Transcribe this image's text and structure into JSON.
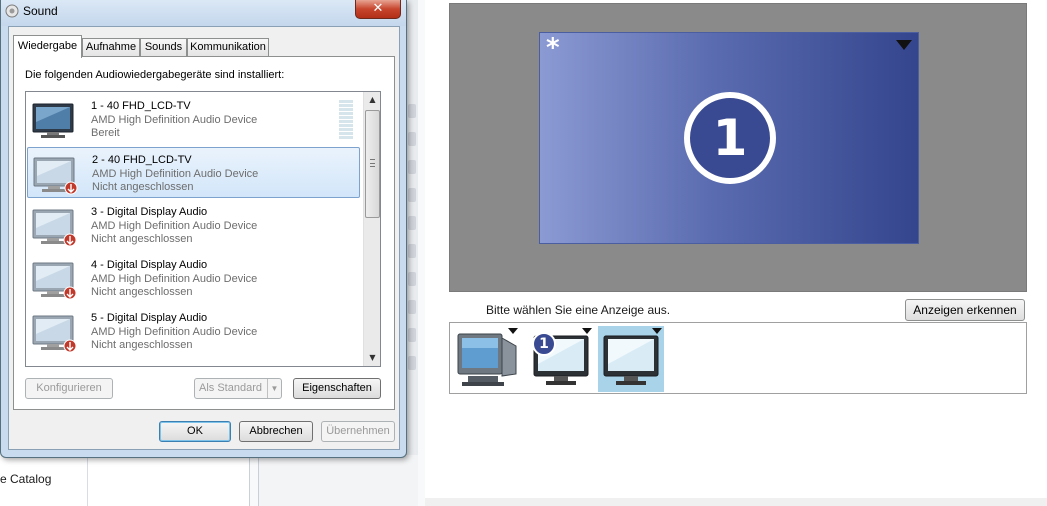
{
  "background": {
    "catalog_text": "e Catalog"
  },
  "dialog": {
    "title": "Sound",
    "close_label": "✕",
    "tabs": [
      {
        "label": "Wiedergabe",
        "active": true
      },
      {
        "label": "Aufnahme",
        "active": false
      },
      {
        "label": "Sounds",
        "active": false
      },
      {
        "label": "Kommunikation",
        "active": false
      }
    ],
    "description": "Die folgenden Audiowiedergabegeräte sind installiert:",
    "devices": [
      {
        "name": "1 - 40 FHD_LCD-TV",
        "driver": "AMD High Definition Audio Device",
        "status": "Bereit",
        "selected": false,
        "disconnected": false
      },
      {
        "name": "2 - 40 FHD_LCD-TV",
        "driver": "AMD High Definition Audio Device",
        "status": "Nicht angeschlossen",
        "selected": true,
        "disconnected": true
      },
      {
        "name": "3 - Digital Display Audio",
        "driver": "AMD High Definition Audio Device",
        "status": "Nicht angeschlossen",
        "selected": false,
        "disconnected": true
      },
      {
        "name": "4 - Digital Display Audio",
        "driver": "AMD High Definition Audio Device",
        "status": "Nicht angeschlossen",
        "selected": false,
        "disconnected": true
      },
      {
        "name": "5 - Digital Display Audio",
        "driver": "AMD High Definition Audio Device",
        "status": "Nicht angeschlossen",
        "selected": false,
        "disconnected": true
      }
    ],
    "buttons": {
      "configure": "Konfigurieren",
      "set_default": "Als Standard",
      "properties": "Eigenschaften",
      "ok": "OK",
      "cancel": "Abbrechen",
      "apply": "Übernehmen"
    }
  },
  "display_settings": {
    "preview_star": "*",
    "preview_badge": "1",
    "choose_label": "Bitte wählen Sie eine Anzeige aus.",
    "detect_button": "Anzeigen erkennen",
    "displays": [
      {
        "type": "crt",
        "badge": "",
        "selected": false
      },
      {
        "type": "lcd",
        "badge": "1",
        "selected": false
      },
      {
        "type": "lcd",
        "badge": "",
        "selected": true
      }
    ]
  },
  "colors": {
    "accent": "#3a4a92",
    "selection": "#a8d3e8",
    "disconnected": "#c0392b"
  }
}
